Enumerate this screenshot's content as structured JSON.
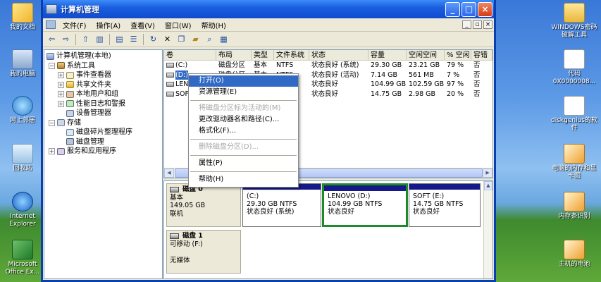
{
  "desktop": {
    "left_icons": [
      {
        "label": "我的文档",
        "icon": "documents-icon"
      },
      {
        "label": "我的电脑",
        "icon": "computer-icon"
      },
      {
        "label": "网上邻居",
        "icon": "network-icon"
      },
      {
        "label": "回收站",
        "icon": "recycle-bin-icon"
      },
      {
        "label": "Internet Explorer",
        "icon": "ie-icon"
      },
      {
        "label": "Microsoft Office Ex...",
        "icon": "excel-icon"
      }
    ],
    "right_icons": [
      {
        "label": "WINDOWS密码破解工具",
        "icon": "folder-icon"
      },
      {
        "label": "代码0X0000008...",
        "icon": "text-file-icon"
      },
      {
        "label": "diskgenius的软件",
        "icon": "text-file-icon"
      },
      {
        "label": "电脑的内存和显卡图",
        "icon": "jpg-icon"
      },
      {
        "label": "内存条识别",
        "icon": "jpg-icon"
      },
      {
        "label": "主机的电池",
        "icon": "jpg-icon"
      }
    ]
  },
  "window": {
    "title": "计算机管理",
    "menu": [
      "文件(F)",
      "操作(A)",
      "查看(V)",
      "窗口(W)",
      "帮助(H)"
    ],
    "toolbar_icons": [
      "back-icon",
      "forward-icon",
      "up-icon",
      "show-tree-icon",
      "export-icon",
      "properties-icon",
      "refresh-icon",
      "delete-icon",
      "copy-icon",
      "open-icon",
      "search-icon",
      "help-icon"
    ]
  },
  "tree": [
    {
      "label": "计算机管理(本地)",
      "level": 0,
      "expander": "",
      "icon": "mgmt"
    },
    {
      "label": "系统工具",
      "level": 1,
      "expander": "−",
      "icon": "tool"
    },
    {
      "label": "事件查看器",
      "level": 2,
      "expander": "+",
      "icon": "evt"
    },
    {
      "label": "共享文件夹",
      "level": 2,
      "expander": "+",
      "icon": "folder"
    },
    {
      "label": "本地用户和组",
      "level": 2,
      "expander": "+",
      "icon": "users"
    },
    {
      "label": "性能日志和警报",
      "level": 2,
      "expander": "+",
      "icon": "perf"
    },
    {
      "label": "设备管理器",
      "level": 2,
      "expander": "",
      "icon": "dev"
    },
    {
      "label": "存储",
      "level": 1,
      "expander": "−",
      "icon": "storage"
    },
    {
      "label": "磁盘碎片整理程序",
      "level": 2,
      "expander": "",
      "icon": "defrag"
    },
    {
      "label": "磁盘管理",
      "level": 2,
      "expander": "",
      "icon": "disk"
    },
    {
      "label": "服务和应用程序",
      "level": 1,
      "expander": "+",
      "icon": "svc"
    }
  ],
  "volumes": {
    "headers": [
      "卷",
      "布局",
      "类型",
      "文件系统",
      "状态",
      "容量",
      "空闲空间",
      "% 空闲",
      "容错"
    ],
    "rows": [
      [
        "(C:)",
        "磁盘分区",
        "基本",
        "NTFS",
        "状态良好 (系统)",
        "29.30 GB",
        "23.21 GB",
        "79 %",
        "否"
      ],
      [
        "(D:)",
        "磁盘分区",
        "基本",
        "NTFS",
        "状态良好 (活动)",
        "7.14 GB",
        "561 MB",
        "7 %",
        "否"
      ],
      [
        "LENOVO",
        "",
        "",
        "",
        "状态良好",
        "104.99 GB",
        "102.59 GB",
        "97 %",
        "否"
      ],
      [
        "SOFT",
        "",
        "",
        "",
        "状态良好",
        "14.75 GB",
        "2.98 GB",
        "20 %",
        "否"
      ]
    ]
  },
  "disks": [
    {
      "name": "磁盘 0",
      "info": [
        "基本",
        "149.05 GB",
        "联机"
      ],
      "partitions": [
        {
          "name": "(C:)",
          "size": "29.30 GB NTFS",
          "status": "状态良好 (系统)",
          "selected": false
        },
        {
          "name": "LENOVO  (D:)",
          "size": "104.99 GB NTFS",
          "status": "状态良好",
          "selected": true
        },
        {
          "name": "SOFT  (E:)",
          "size": "14.75 GB NTFS",
          "status": "状态良好",
          "selected": false
        }
      ]
    },
    {
      "name": "磁盘 1",
      "info": [
        "可移动 (F:)",
        "",
        "无媒体"
      ],
      "partitions": []
    }
  ],
  "context_menu": [
    {
      "label": "打开(O)",
      "state": "highlighted"
    },
    {
      "label": "资源管理(E)",
      "state": "enabled"
    },
    {
      "sep": true
    },
    {
      "label": "将磁盘分区标为活动的(M)",
      "state": "disabled"
    },
    {
      "label": "更改驱动器名和路径(C)...",
      "state": "enabled"
    },
    {
      "label": "格式化(F)...",
      "state": "enabled"
    },
    {
      "sep": true
    },
    {
      "label": "删除磁盘分区(D)...",
      "state": "disabled"
    },
    {
      "sep": true
    },
    {
      "label": "属性(P)",
      "state": "enabled"
    },
    {
      "sep": true
    },
    {
      "label": "帮助(H)",
      "state": "enabled"
    }
  ]
}
